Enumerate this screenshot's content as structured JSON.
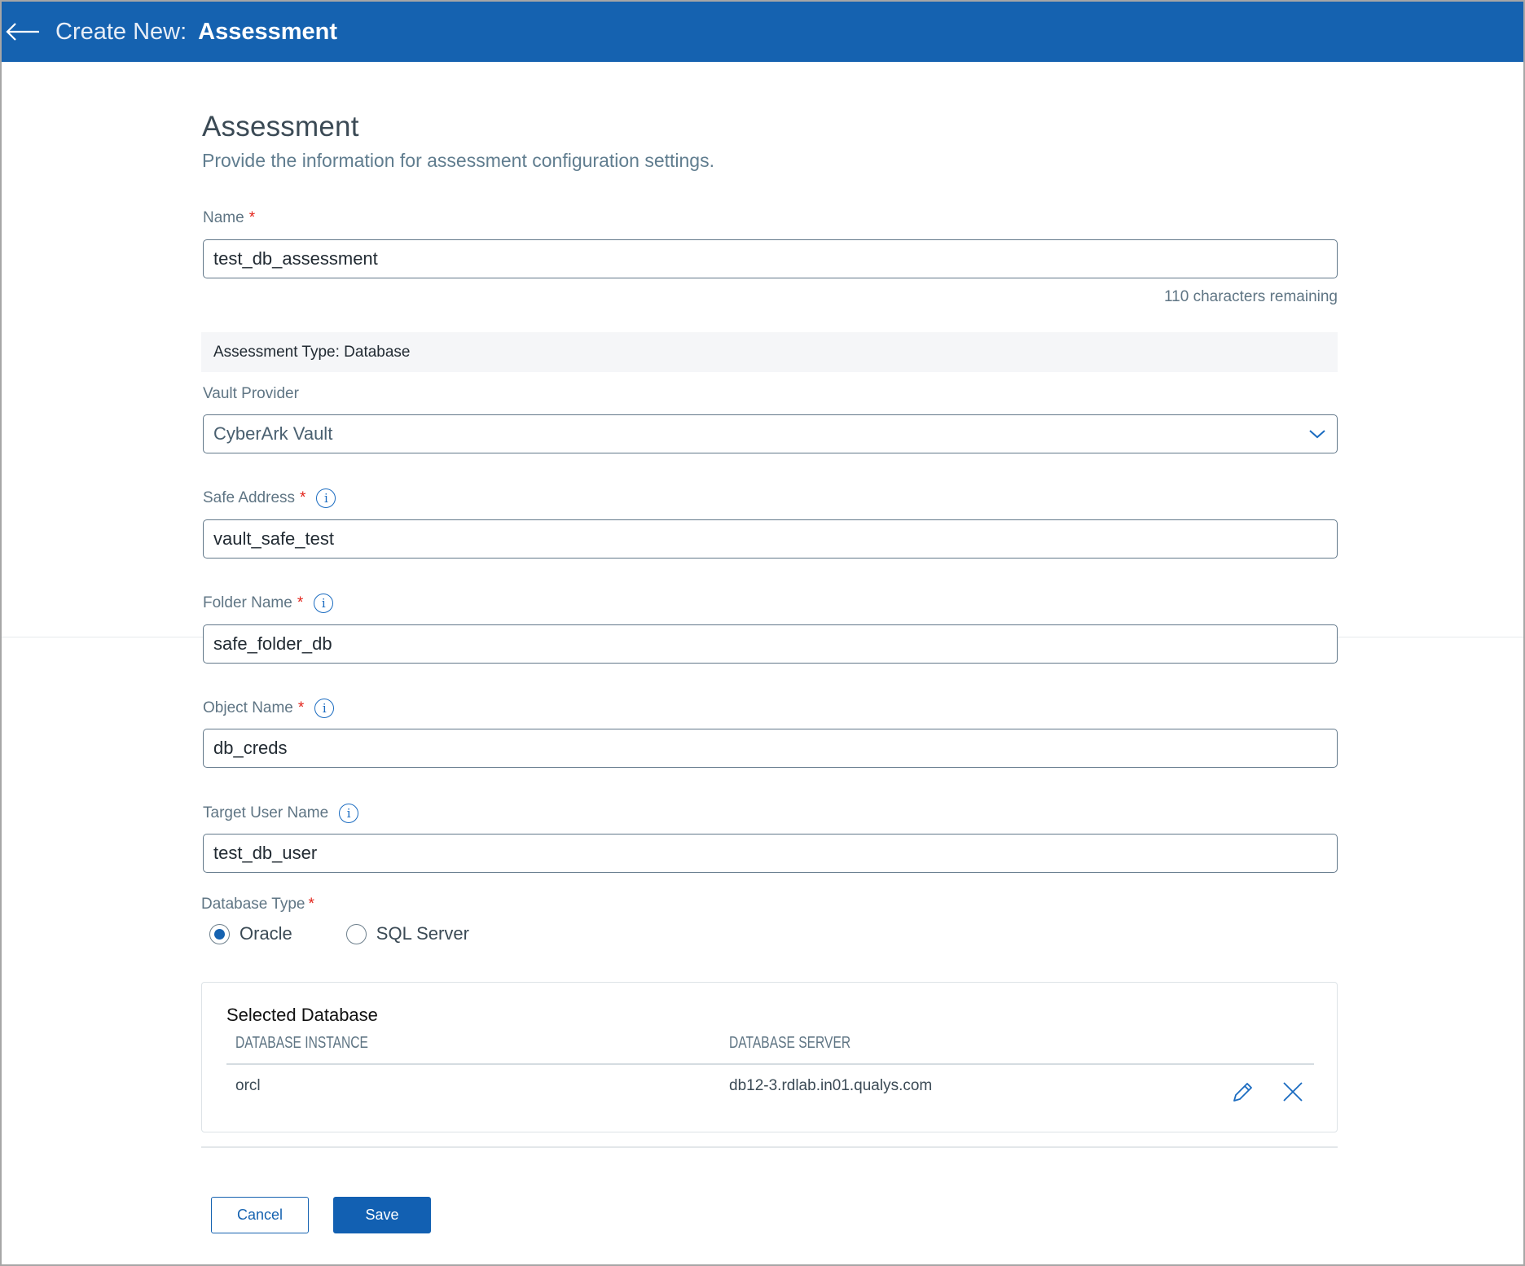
{
  "header": {
    "back_icon": "arrow-left-icon",
    "prefix": "Create New:",
    "title": "Assessment",
    "color": "#1562b0"
  },
  "page": {
    "title": "Assessment",
    "subtitle": "Provide the information for assessment configuration settings."
  },
  "form": {
    "name": {
      "label": "Name",
      "required": "*",
      "value": "test_db_assessment",
      "counter": "110 characters remaining"
    },
    "assessment_type": "Assessment Type: Database",
    "vault_provider": {
      "label": "Vault Provider",
      "value": "CyberArk Vault",
      "icon": "chevron-down-icon"
    },
    "safe_address": {
      "label": "Safe Address",
      "required": "*",
      "info_icon": "i",
      "value": "vault_safe_test"
    },
    "folder_name": {
      "label": "Folder Name",
      "required": "*",
      "info_icon": "i",
      "value": "safe_folder_db"
    },
    "object_name": {
      "label": "Object Name",
      "required": "*",
      "info_icon": "i",
      "value": "db_creds"
    },
    "target_user_name": {
      "label": "Target User Name",
      "info_icon": "i",
      "value": "test_db_user"
    },
    "database_type": {
      "label": "Database Type",
      "required": "*",
      "options": [
        {
          "label": "Oracle",
          "selected": true
        },
        {
          "label": "SQL Server",
          "selected": false
        }
      ]
    }
  },
  "selected_database": {
    "title": "Selected Database",
    "columns": [
      "DATABASE INSTANCE",
      "DATABASE SERVER"
    ],
    "rows": [
      {
        "instance": "orcl",
        "server": "db12-3.rdlab.in01.qualys.com"
      }
    ],
    "actions": [
      "pencil-icon",
      "close-icon"
    ]
  },
  "buttons": {
    "cancel": "Cancel",
    "save": "Save"
  }
}
